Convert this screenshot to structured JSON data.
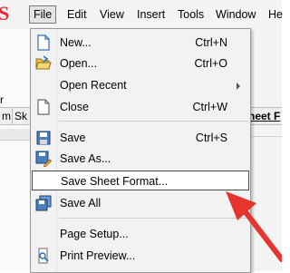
{
  "colors": {
    "menu_background": "#f2f2f2",
    "highlight_border": "#4a4a4a",
    "annotation_arrow": "#e5352e",
    "logo": "#e8283a"
  },
  "app": {
    "logo_fragment": "S",
    "left_tab_fragments": [
      "m",
      "Sk"
    ],
    "right_tab_fragment": "heet F"
  },
  "menubar": {
    "items": [
      "File",
      "Edit",
      "View",
      "Insert",
      "Tools",
      "Window",
      "He"
    ]
  },
  "file_menu": {
    "items": [
      {
        "label": "New...",
        "shortcut": "Ctrl+N",
        "icon": "new-document-icon"
      },
      {
        "label": "Open...",
        "shortcut": "Ctrl+O",
        "icon": "open-folder-icon"
      },
      {
        "label": "Open Recent",
        "shortcut": "",
        "icon": "",
        "submenu": true
      },
      {
        "label": "Close",
        "shortcut": "Ctrl+W",
        "icon": "close-document-icon"
      },
      {
        "label": "Save",
        "shortcut": "Ctrl+S",
        "icon": "save-icon"
      },
      {
        "label": "Save As...",
        "shortcut": "",
        "icon": "save-as-icon"
      },
      {
        "label": "Save Sheet Format...",
        "shortcut": "",
        "icon": "",
        "highlighted": true
      },
      {
        "label": "Save All",
        "shortcut": "",
        "icon": "save-all-icon"
      },
      {
        "label": "Page Setup...",
        "shortcut": "",
        "icon": ""
      },
      {
        "label": "Print Preview...",
        "shortcut": "",
        "icon": "print-preview-icon"
      }
    ]
  }
}
